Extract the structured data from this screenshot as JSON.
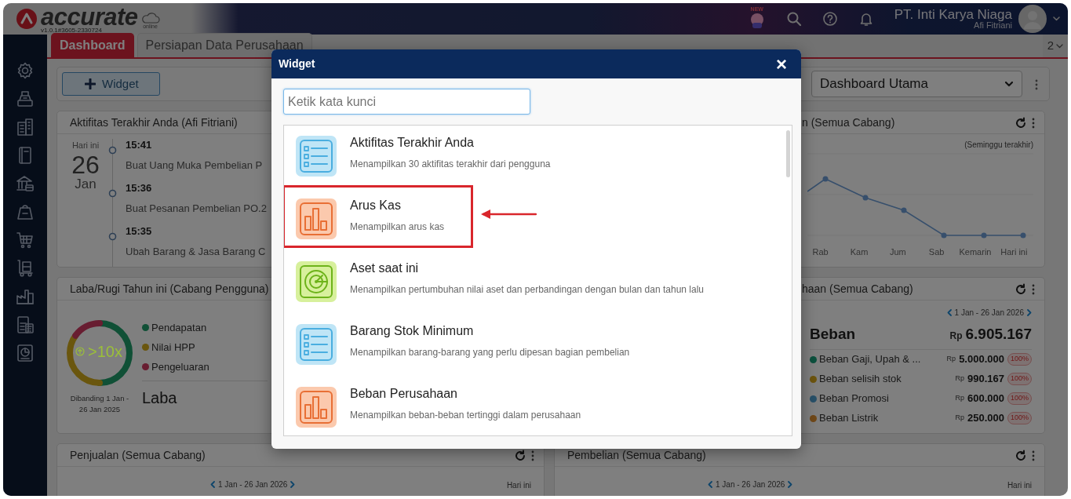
{
  "header": {
    "logo": "accurate",
    "logo_suffix": "online",
    "version": "v1.0.1#3605-2330724",
    "new_badge": "NEW",
    "company": "PT. Inti Karya Niaga",
    "user": "Afi Fitriani"
  },
  "tabs": [
    {
      "label": "Dashboard",
      "selected": true
    },
    {
      "label": "Persiapan Data Perusahaan",
      "selected": false
    }
  ],
  "tab_count": "2",
  "toolbar": {
    "add_button": "Widget",
    "dashboard_select": "Dashboard Utama"
  },
  "activity_panel": {
    "title": "Aktifitas Terakhir Anda (Afi Fitriani)",
    "day_label": "Hari ini",
    "day": "26",
    "month": "Jan",
    "entries": [
      {
        "time": "15:41",
        "text": "Buat Uang Muka Pembelian P"
      },
      {
        "time": "15:36",
        "text": "Buat Pesanan Pembelian PO.2"
      },
      {
        "time": "15:35",
        "text": "Ubah Barang & Jasa Barang C"
      }
    ]
  },
  "sales_trend_panel": {
    "title": "n (Semua Cabang)",
    "period": "(Seminggu terakhir)",
    "x_labels": [
      "Rab",
      "Kam",
      "Jum",
      "Sab",
      "Kemarin",
      "Hari ini"
    ]
  },
  "profit_panel": {
    "title": "Laba/Rugi Tahun ini (Cabang Pengguna)",
    "ratio": ">10x",
    "legend": [
      {
        "label": "Pendapatan",
        "color": "#105036"
      },
      {
        "label": "Nilai HPP",
        "color": "#6a560e"
      },
      {
        "label": "Pengeluaran",
        "color": "#681d31"
      }
    ],
    "comparison": "Dibanding 1 Jan - 26 Jan 2025",
    "result": "Laba"
  },
  "expense_panel": {
    "title": "haan (Semua Cabang)",
    "date_range": "1 Jan - 26 Jan 2026",
    "heading": "Beban",
    "currency": "Rp",
    "total": "6.905.167",
    "rows": [
      {
        "label": "Beban Gaji, Upah & ...",
        "currency": "Rp",
        "amount": "5.000.000",
        "change": "100%",
        "color": "#0c503d"
      },
      {
        "label": "Beban selisih stok",
        "currency": "Rp",
        "amount": "990.167",
        "change": "100%",
        "color": "#6c540e"
      },
      {
        "label": "Beban Promosi",
        "currency": "Rp",
        "amount": "600.000",
        "change": "100%",
        "color": "#285068"
      },
      {
        "label": "Beban Listrik",
        "currency": "Rp",
        "amount": "250.000",
        "change": "100%",
        "color": "#704818"
      }
    ]
  },
  "sales_panel": {
    "title": "Penjualan (Semua Cabang)",
    "date_range": "1 Jan - 26 Jan 2026",
    "period": "Hari ini"
  },
  "purchase_panel": {
    "title": "Pembelian (Semua Cabang)",
    "date_range": "1 Jan - 26 Jan 2026",
    "period": "Hari ini"
  },
  "widget_dialog": {
    "title": "Widget",
    "close": "×",
    "search": {
      "placeholder": "Ketik kata kunci"
    },
    "items": [
      {
        "kind": "list",
        "title": "Aktifitas Terakhir Anda",
        "description": "Menampilkan 30 aktifitas terakhir dari pengguna",
        "highlighted": false
      },
      {
        "kind": "bars",
        "title": "Arus Kas",
        "description": "Menampilkan arus kas",
        "highlighted": true
      },
      {
        "kind": "dial",
        "title": "Aset saat ini",
        "description": "Menampilkan pertumbuhan nilai aset dan perbandingan dengan bulan dan tahun lalu",
        "highlighted": false
      },
      {
        "kind": "list",
        "title": "Barang Stok Minimum",
        "description": "Menampilkan barang-barang yang perlu dipesan bagian pembelian",
        "highlighted": false
      },
      {
        "kind": "bars",
        "title": "Beban Perusahaan",
        "description": "Menampilkan beban-beban tertinggi dalam perusahaan",
        "highlighted": false
      }
    ]
  }
}
